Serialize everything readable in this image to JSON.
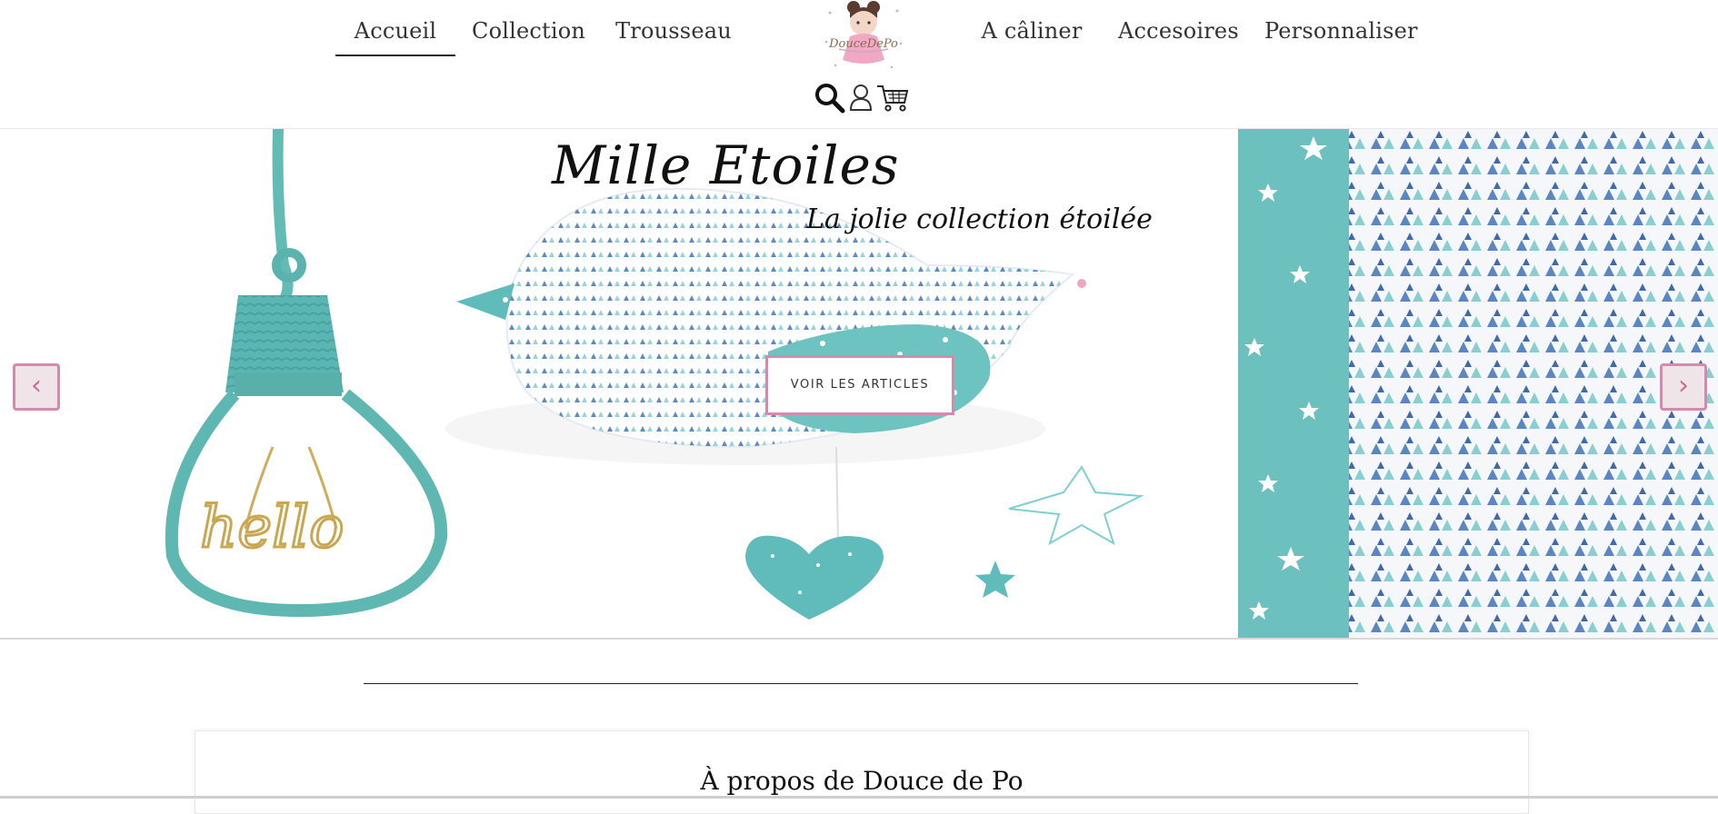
{
  "nav": {
    "left": [
      {
        "label": "Accueil",
        "active": true
      },
      {
        "label": "Collection",
        "active": false
      },
      {
        "label": "Trousseau",
        "active": false
      }
    ],
    "right": [
      {
        "label": "A câliner",
        "active": false
      },
      {
        "label": "Accesoires",
        "active": false
      },
      {
        "label": "Personnaliser",
        "active": false
      }
    ]
  },
  "logo": {
    "text": "DouceDePo"
  },
  "header_icons": [
    "search-icon",
    "user-icon",
    "cart-icon"
  ],
  "hero": {
    "title": "Mille Etoiles",
    "subtitle": "La jolie collection étoilée",
    "cta_label": "VOIR LES ARTICLES",
    "wire_text": "hello",
    "prev_label": "‹",
    "next_label": "›"
  },
  "about": {
    "title": "À propos de Douce de Po"
  },
  "colors": {
    "accent_pink": "#d58aad",
    "teal": "#5fbdbd",
    "blue_pattern": "#4a78b8",
    "light_teal": "#8fd0d0"
  }
}
